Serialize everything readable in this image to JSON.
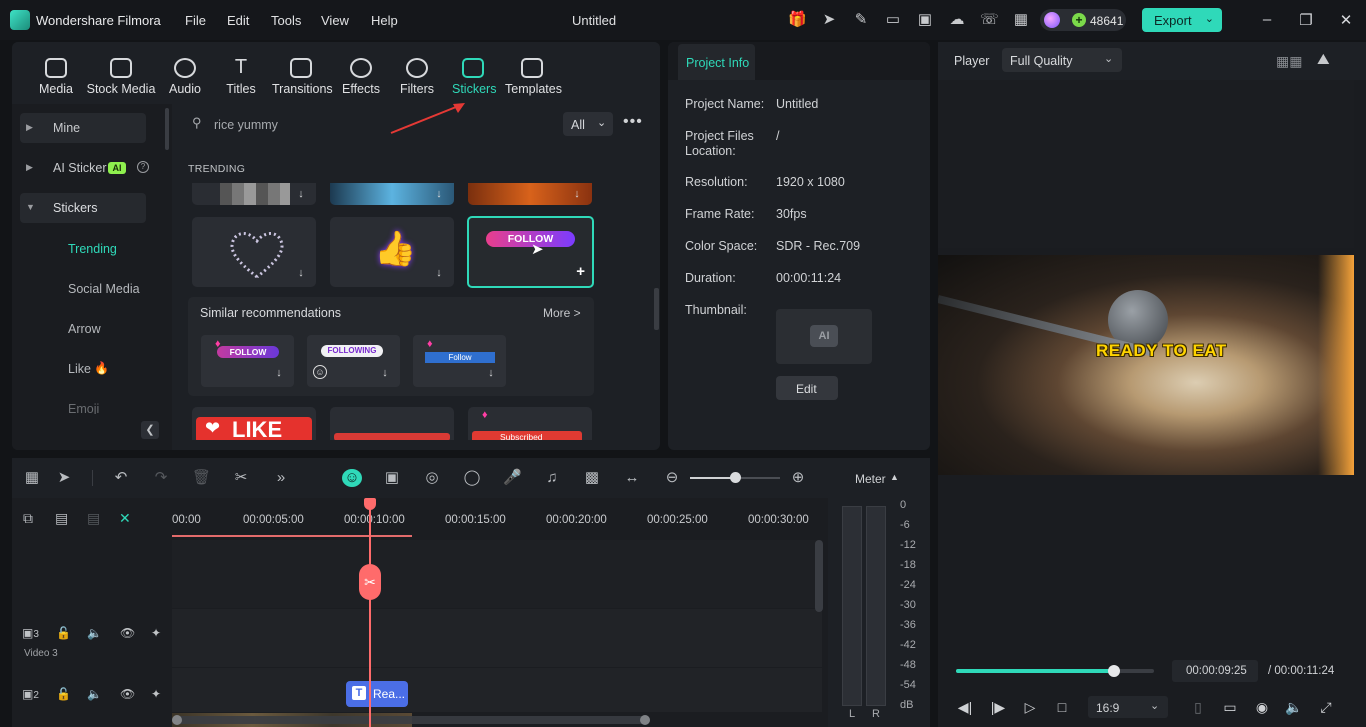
{
  "app": {
    "name": "Wondershare Filmora",
    "title": "Untitled"
  },
  "menu": [
    "File",
    "Edit",
    "Tools",
    "View",
    "Help"
  ],
  "credits": "48641",
  "export_label": "Export",
  "media_tabs": [
    {
      "label": "Media"
    },
    {
      "label": "Stock Media"
    },
    {
      "label": "Audio"
    },
    {
      "label": "Titles"
    },
    {
      "label": "Transitions"
    },
    {
      "label": "Effects"
    },
    {
      "label": "Filters"
    },
    {
      "label": "Stickers"
    },
    {
      "label": "Templates"
    }
  ],
  "sidebar": {
    "items": [
      {
        "label": "Mine"
      },
      {
        "label": "AI Sticker"
      },
      {
        "label": "Stickers"
      }
    ],
    "ai_badge": "AI",
    "sub_items": [
      {
        "label": "Trending"
      },
      {
        "label": "Social Media"
      },
      {
        "label": "Arrow"
      },
      {
        "label": "Like"
      },
      {
        "label": "Emoji"
      }
    ]
  },
  "search": {
    "value": "rice yummy",
    "filter": "All"
  },
  "trending_heading": "TRENDING",
  "stickers": {
    "follow_text": "FOLLOW",
    "like_text": "LIKE"
  },
  "similar": {
    "title": "Similar recommendations",
    "more": "More >",
    "items": [
      {
        "text": "FOLLOW"
      },
      {
        "text": "FOLLOWING"
      },
      {
        "text": "Follow"
      }
    ],
    "subscribed_text": "Subscribed"
  },
  "project_info": {
    "tab": "Project Info",
    "rows": [
      {
        "label": "Project Name:",
        "value": "Untitled"
      },
      {
        "label": "Project Files Location:",
        "value": "/"
      },
      {
        "label": "Resolution:",
        "value": "1920 x 1080"
      },
      {
        "label": "Frame Rate:",
        "value": "30fps"
      },
      {
        "label": "Color Space:",
        "value": "SDR - Rec.709"
      },
      {
        "label": "Duration:",
        "value": "00:00:11:24"
      }
    ],
    "thumbnail_label": "Thumbnail:",
    "thumbnail_badge": "AI",
    "edit_label": "Edit"
  },
  "player": {
    "label": "Player",
    "quality": "Full Quality",
    "overlay_text": "READY TO EAT",
    "current_time": "00:00:09:25",
    "total_time": "/ 00:00:11:24",
    "aspect": "16:9",
    "progress": 0.8
  },
  "timeline": {
    "ruler": [
      "00:00",
      "00:00:05:00",
      "00:00:10:00",
      "00:00:15:00",
      "00:00:20:00",
      "00:00:25:00",
      "00:00:30:00"
    ],
    "tracks": [
      {
        "num": "3",
        "name": "Video 3"
      },
      {
        "num": "2"
      }
    ],
    "clip_label": "Rea..."
  },
  "meter": {
    "title": "Meter",
    "scale": [
      "0",
      "-6",
      "-12",
      "-18",
      "-24",
      "-30",
      "-36",
      "-42",
      "-48",
      "-54",
      "dB"
    ],
    "left": "L",
    "right": "R"
  },
  "colors": {
    "accent": "#2fd9b9",
    "playhead": "#ff6b6b",
    "panel": "#1d2025"
  }
}
